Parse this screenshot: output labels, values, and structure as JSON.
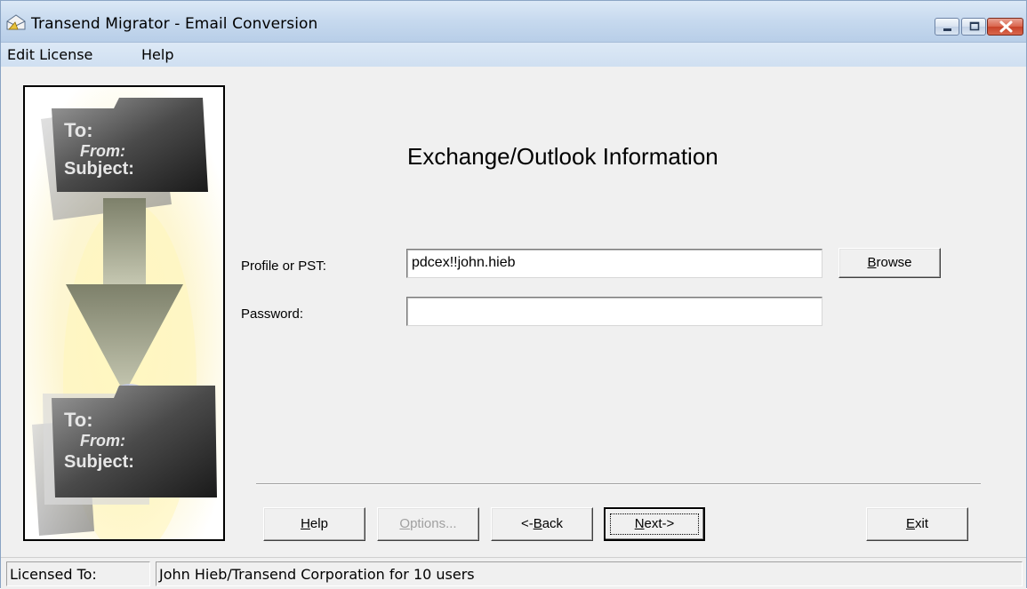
{
  "window": {
    "title": "Transend Migrator - Email Conversion",
    "controls": {
      "minimize": "minimize-icon",
      "maximize": "maximize-icon",
      "close": "close-icon"
    }
  },
  "menu": {
    "items": [
      "Edit License",
      "Help"
    ]
  },
  "side_image": {
    "top_card": {
      "to": "To:",
      "from": "From:",
      "subject": "Subject:"
    },
    "bottom_card": {
      "to": "To:",
      "from": "From:",
      "subject": "Subject:"
    }
  },
  "form": {
    "heading": "Exchange/Outlook Information",
    "profile_label": "Profile or PST:",
    "profile_value": "pdcex!!john.hieb",
    "password_label": "Password:",
    "password_value": "",
    "browse_label_prefix": "",
    "browse_label_ul": "B",
    "browse_label_rest": "rowse"
  },
  "buttons": {
    "help": {
      "ul": "H",
      "rest": "elp"
    },
    "options": {
      "ul": "O",
      "rest": "ptions..."
    },
    "back": {
      "prefix": "<-",
      "ul": "B",
      "rest": "ack"
    },
    "next": {
      "ul": "N",
      "rest": "ext->"
    },
    "exit": {
      "ul": "E",
      "rest": "xit"
    }
  },
  "status": {
    "label": "Licensed To:",
    "value": "John Hieb/Transend Corporation for 10 users"
  },
  "colors": {
    "title_bar": "#c6d9ee",
    "close_button": "#c8432a",
    "face": "#f0f0f0"
  }
}
